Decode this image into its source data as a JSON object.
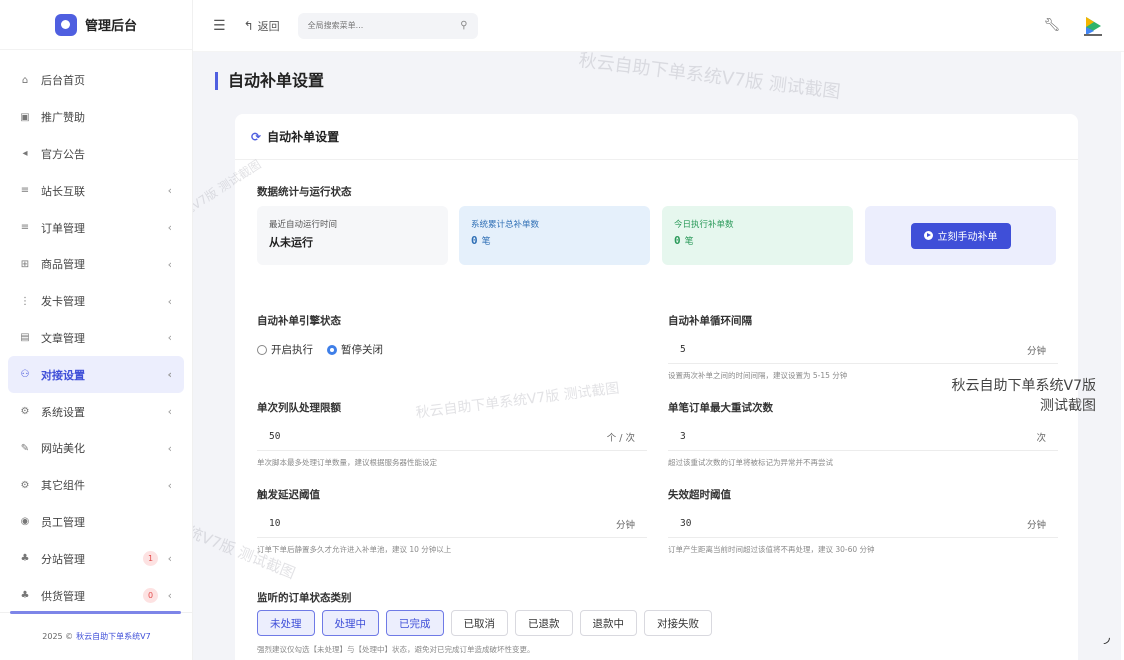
{
  "brand": {
    "title": "管理后台"
  },
  "sidebar": {
    "items": [
      {
        "label": "后台首页",
        "icon": "⌂",
        "chevron": ""
      },
      {
        "label": "推广赞助",
        "icon": "▣",
        "chevron": ""
      },
      {
        "label": "官方公告",
        "icon": "◂",
        "chevron": ""
      },
      {
        "label": "站长互联",
        "icon": "≡",
        "chevron": "‹"
      },
      {
        "label": "订单管理",
        "icon": "≡",
        "chevron": "‹"
      },
      {
        "label": "商品管理",
        "icon": "⊞",
        "chevron": "‹"
      },
      {
        "label": "发卡管理",
        "icon": "⋮",
        "chevron": "‹"
      },
      {
        "label": "文章管理",
        "icon": "▤",
        "chevron": "‹"
      },
      {
        "label": "对接设置",
        "icon": "⚇",
        "chevron": "‹",
        "active": true
      },
      {
        "label": "系统设置",
        "icon": "⚙",
        "chevron": "‹"
      },
      {
        "label": "网站美化",
        "icon": "✎",
        "chevron": "‹"
      },
      {
        "label": "其它组件",
        "icon": "⚙",
        "chevron": "‹"
      },
      {
        "label": "员工管理",
        "icon": "◉",
        "chevron": ""
      },
      {
        "label": "分站管理",
        "icon": "♣",
        "chevron": "‹",
        "badge": "1"
      },
      {
        "label": "供货管理",
        "icon": "♣",
        "chevron": "‹",
        "badge": "0"
      }
    ],
    "footer_prefix": "2025 ©",
    "footer_brand": "秋云自助下单系统V7"
  },
  "topbar": {
    "back_label": "返回",
    "search_placeholder": "全局搜索菜单..."
  },
  "page": {
    "title": "自动补单设置",
    "card_title": "自动补单设置",
    "stats_section": "数据统计与运行状态",
    "stats": {
      "last_run_label": "最近自动运行时间",
      "last_run_value": "从未运行",
      "total_label": "系统累计总补单数",
      "total_value": "0",
      "total_unit": "笔",
      "today_label": "今日执行补单数",
      "today_value": "0",
      "today_unit": "笔",
      "manual_button": "立刻手动补单"
    },
    "engine_label": "自动补单引擎状态",
    "engine_on": "开启执行",
    "engine_off": "暂停关闭",
    "interval_label": "自动补单循环间隔",
    "interval_value": "5",
    "interval_unit": "分钟",
    "interval_hint": "设置两次补单之间的时间间隔，建议设置为 5-15 分钟",
    "queue_label": "单次列队处理限额",
    "queue_value": "50",
    "queue_unit": "个 / 次",
    "queue_hint": "单次脚本最多处理订单数量，建议根据服务器性能设定",
    "retry_label": "单笔订单最大重试次数",
    "retry_value": "3",
    "retry_unit": "次",
    "retry_hint": "超过该重试次数的订单将被标记为异常并不再尝试",
    "delay_label": "触发延迟阈值",
    "delay_value": "10",
    "delay_unit": "分钟",
    "delay_hint": "订单下单后静置多久才允许进入补单池，建议 10 分钟以上",
    "timeout_label": "失效超时阈值",
    "timeout_value": "30",
    "timeout_unit": "分钟",
    "timeout_hint": "订单产生距离当前时间超过该值将不再处理，建议 30-60 分钟",
    "status_label": "监听的订单状态类别",
    "statuses": [
      {
        "label": "未处理",
        "on": true
      },
      {
        "label": "处理中",
        "on": true
      },
      {
        "label": "已完成",
        "on": true
      },
      {
        "label": "已取消",
        "on": false
      },
      {
        "label": "已退款",
        "on": false
      },
      {
        "label": "退款中",
        "on": false
      },
      {
        "label": "对接失败",
        "on": false
      }
    ],
    "status_hint": "强烈建议仅勾选【未处理】与【处理中】状态，避免对已完成订单造成破坏性变更。"
  },
  "watermark": {
    "text": "秋云自助下单系统V7版 测试截图",
    "side_line1": "秋云自助下单系统V7版",
    "side_line2": "测试截图"
  },
  "colors": {
    "accent": "#3f4fd8",
    "blue_card": "#e5f0fb",
    "green_card": "#e6f7ee"
  }
}
